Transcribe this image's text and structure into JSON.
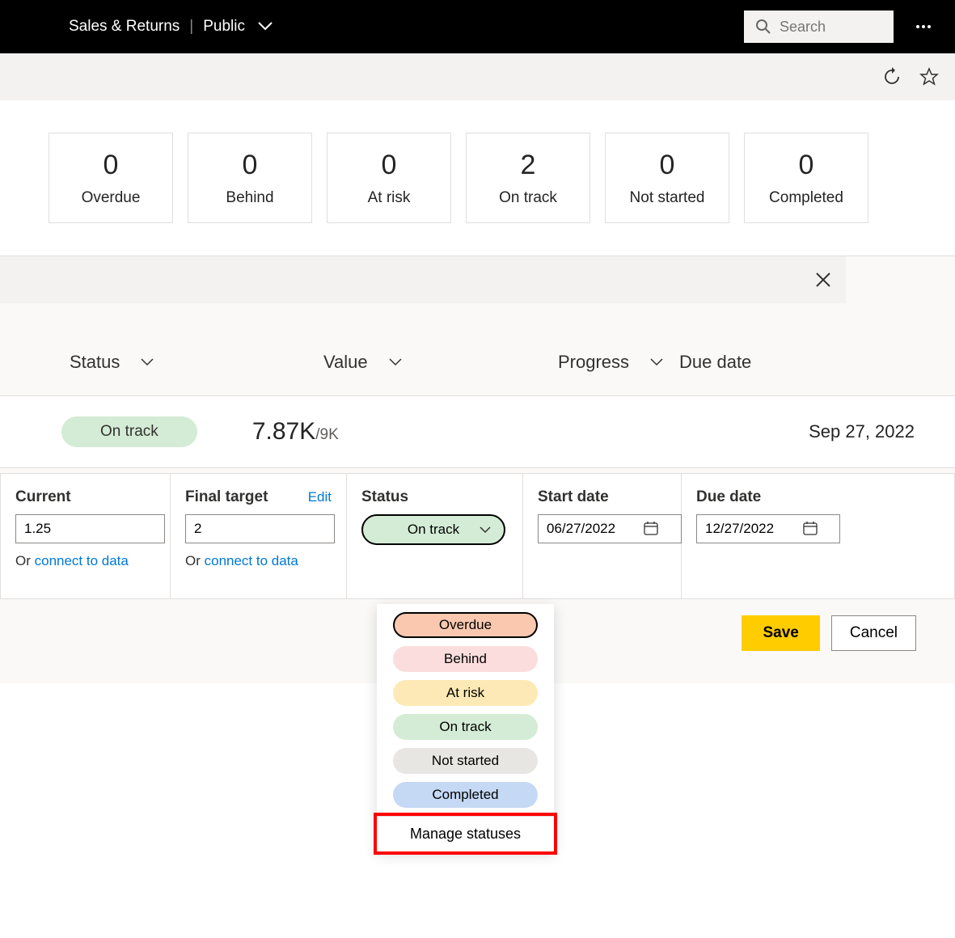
{
  "header": {
    "title": "Sales & Returns",
    "visibility": "Public",
    "search_placeholder": "Search"
  },
  "status_cards": [
    {
      "count": "0",
      "label": "Overdue"
    },
    {
      "count": "0",
      "label": "Behind"
    },
    {
      "count": "0",
      "label": "At risk"
    },
    {
      "count": "2",
      "label": "On track"
    },
    {
      "count": "0",
      "label": "Not started"
    },
    {
      "count": "0",
      "label": "Completed"
    }
  ],
  "columns": {
    "status": "Status",
    "value": "Value",
    "progress": "Progress",
    "due_date": "Due date"
  },
  "row": {
    "status": "On track",
    "value": "7.87K",
    "target": "/9K",
    "due": "Sep 27, 2022"
  },
  "form": {
    "current_label": "Current",
    "current_value": "1.25",
    "final_target_label": "Final target",
    "final_target_value": "2",
    "edit_label": "Edit",
    "connect_prefix": "Or ",
    "connect_link": "connect to data",
    "status_label": "Status",
    "status_value": "On track",
    "start_label": "Start date",
    "start_value": "06/27/2022",
    "due_label": "Due date",
    "due_value": "12/27/2022"
  },
  "status_options": {
    "overdue": "Overdue",
    "behind": "Behind",
    "at_risk": "At risk",
    "on_track": "On track",
    "not_started": "Not started",
    "completed": "Completed",
    "manage": "Manage statuses"
  },
  "actions": {
    "save": "Save",
    "cancel": "Cancel"
  },
  "colors": {
    "accent_yellow": "#ffcc00",
    "on_track_green": "#d4ecd5",
    "overdue_red": "#f9c8af",
    "link_blue": "#0078d4"
  }
}
